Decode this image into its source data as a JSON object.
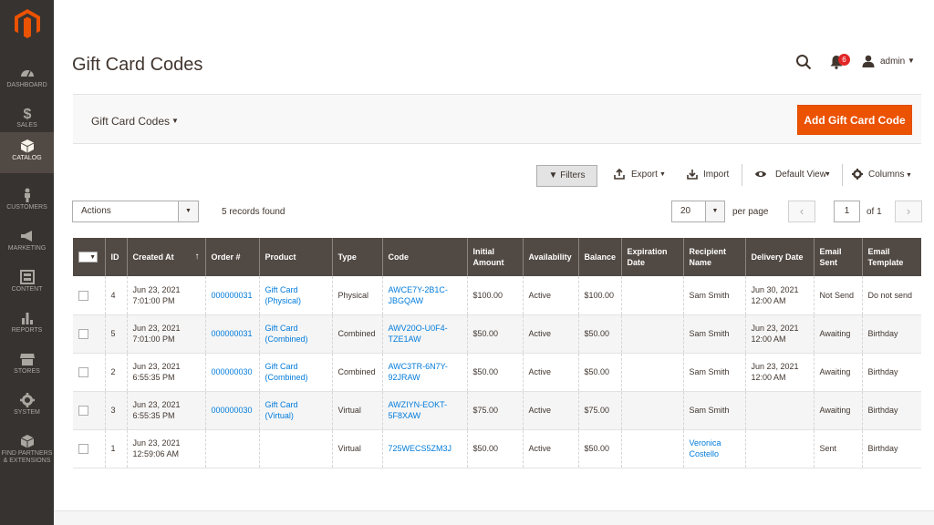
{
  "sidebar": {
    "items": [
      {
        "label": "DASHBOARD",
        "icon": "dashboard-icon"
      },
      {
        "label": "SALES",
        "icon": "dollar-icon"
      },
      {
        "label": "CATALOG",
        "icon": "cube-icon",
        "active": true
      },
      {
        "label": "CUSTOMERS",
        "icon": "person-icon"
      },
      {
        "label": "MARKETING",
        "icon": "megaphone-icon"
      },
      {
        "label": "CONTENT",
        "icon": "layout-icon"
      },
      {
        "label": "REPORTS",
        "icon": "bar-chart-icon"
      },
      {
        "label": "STORES",
        "icon": "store-icon"
      },
      {
        "label": "SYSTEM",
        "icon": "gear-icon"
      },
      {
        "label": "FIND PARTNERS",
        "label2": "& EXTENSIONS",
        "icon": "box-icon"
      }
    ]
  },
  "header": {
    "title": "Gift Card Codes",
    "notifications": "6",
    "user": "admin"
  },
  "actions_bar": {
    "switcher": "Gift Card Codes",
    "add_button": "Add Gift Card Code"
  },
  "toolbar": {
    "filters": "Filters",
    "export": "Export",
    "import": "Import",
    "view": "Default View",
    "columns": "Columns",
    "actions": "Actions",
    "records": "5 records found",
    "per_page_value": "20",
    "per_page_label": "per page",
    "page": "1",
    "of": "of 1"
  },
  "columns": [
    "ID",
    "Created At",
    "Order #",
    "Product",
    "Type",
    "Code",
    "Initial Amount",
    "Availability",
    "Balance",
    "Expiration Date",
    "Recipient Name",
    "Delivery Date",
    "Email Sent",
    "Email Template"
  ],
  "rows": [
    {
      "id": "4",
      "created1": "Jun 23, 2021",
      "created2": "7:01:00 PM",
      "order": "000000031",
      "product1": "Gift Card",
      "product2": "(Physical)",
      "type": "Physical",
      "code1": "AWCE7Y-2B1C-",
      "code2": "JBGQAW",
      "initial": "$100.00",
      "availability": "Active",
      "balance": "$100.00",
      "expiration": "",
      "recipient1": "Sam Smith",
      "recipient2": "",
      "delivery1": "Jun 30, 2021",
      "delivery2": "12:00 AM",
      "email_sent": "Not Send",
      "template": "Do not send"
    },
    {
      "id": "5",
      "created1": "Jun 23, 2021",
      "created2": "7:01:00 PM",
      "order": "000000031",
      "product1": "Gift Card",
      "product2": "(Combined)",
      "type": "Combined",
      "code1": "AWV20O-U0F4-",
      "code2": "TZE1AW",
      "initial": "$50.00",
      "availability": "Active",
      "balance": "$50.00",
      "expiration": "",
      "recipient1": "Sam Smith",
      "recipient2": "",
      "delivery1": "Jun 23, 2021",
      "delivery2": "12:00 AM",
      "email_sent": "Awaiting",
      "template": "Birthday"
    },
    {
      "id": "2",
      "created1": "Jun 23, 2021",
      "created2": "6:55:35 PM",
      "order": "000000030",
      "product1": "Gift Card",
      "product2": "(Combined)",
      "type": "Combined",
      "code1": "AWC3TR-6N7Y-",
      "code2": "92JRAW",
      "initial": "$50.00",
      "availability": "Active",
      "balance": "$50.00",
      "expiration": "",
      "recipient1": "Sam Smith",
      "recipient2": "",
      "delivery1": "Jun 23, 2021",
      "delivery2": "12:00 AM",
      "email_sent": "Awaiting",
      "template": "Birthday"
    },
    {
      "id": "3",
      "created1": "Jun 23, 2021",
      "created2": "6:55:35 PM",
      "order": "000000030",
      "product1": "Gift Card",
      "product2": "(Virtual)",
      "type": "Virtual",
      "code1": "AWZIYN-EOKT-",
      "code2": "5F8XAW",
      "initial": "$75.00",
      "availability": "Active",
      "balance": "$75.00",
      "expiration": "",
      "recipient1": "Sam Smith",
      "recipient2": "",
      "delivery1": "",
      "delivery2": "",
      "email_sent": "Awaiting",
      "template": "Birthday"
    },
    {
      "id": "1",
      "created1": "Jun 23, 2021",
      "created2": "12:59:06 AM",
      "order": "",
      "product1": "",
      "product2": "",
      "type": "Virtual",
      "code1": "725WECS5ZM3J",
      "code2": "",
      "initial": "$50.00",
      "availability": "Active",
      "balance": "$50.00",
      "expiration": "",
      "recipient1": "Veronica",
      "recipient2": "Costello",
      "delivery1": "",
      "delivery2": "",
      "email_sent": "Sent",
      "template": "Birthday"
    }
  ]
}
